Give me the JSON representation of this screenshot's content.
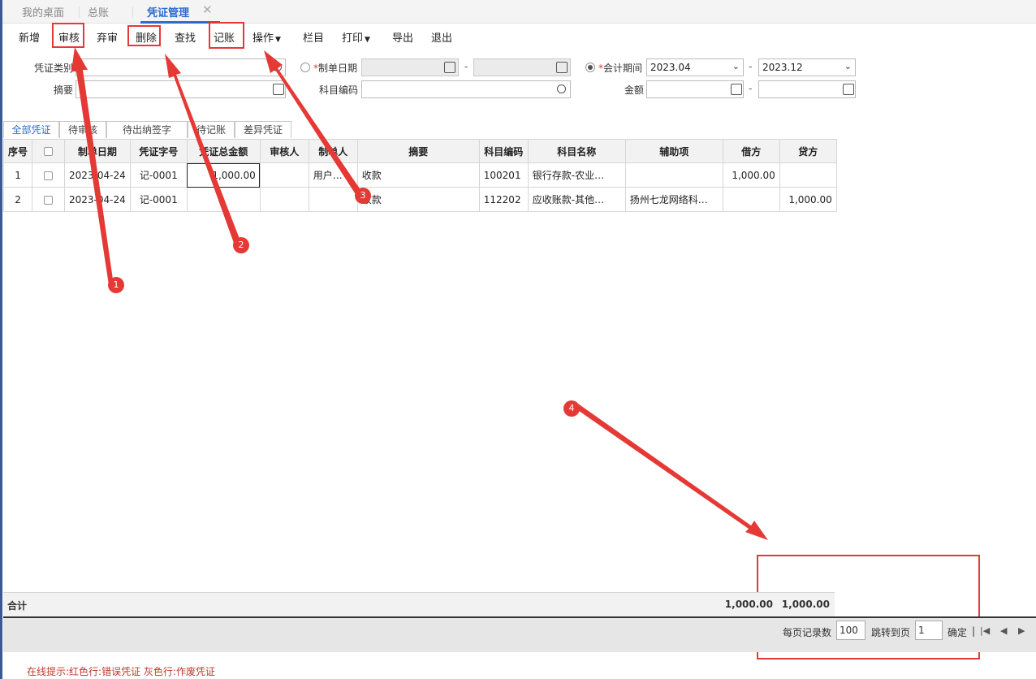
{
  "tabs": [
    {
      "label": "我的桌面"
    },
    {
      "label": "总账"
    },
    {
      "label": "凭证管理"
    }
  ],
  "toolbar": {
    "add": "新增",
    "audit": "审核",
    "abandon_audit": "弃审",
    "delete": "删除",
    "find": "查找",
    "post": "记账",
    "operate": "操作",
    "columns": "栏目",
    "print": "打印",
    "export": "导出",
    "exit": "退出"
  },
  "filters": {
    "voucher_type_label": "凭证类别",
    "voucher_type_value": "",
    "make_date_label": "制单日期",
    "make_date_from": "",
    "make_date_to": "",
    "period_label": "会计期间",
    "period_from": "2023.04",
    "period_to": "2023.12",
    "summary_label": "摘要",
    "summary_value": "",
    "account_code_label": "科目编码",
    "account_code_value": "",
    "amount_label": "金额",
    "amount_from": "",
    "amount_to": "",
    "dash": "-"
  },
  "subtabs": [
    "全部凭证",
    "待审核",
    "待出纳签字",
    "待记账",
    "差异凭证"
  ],
  "table": {
    "headers": [
      "序号",
      "",
      "制单日期",
      "凭证字号",
      "凭证总金额",
      "审核人",
      "制单人",
      "摘要",
      "科目编码",
      "科目名称",
      "辅助项",
      "借方",
      "贷方"
    ],
    "rows": [
      {
        "seq": "1",
        "date": "2023-04-24",
        "voucher_no": "记-0001",
        "total": "1,000.00",
        "auditor": "",
        "maker": "用户…",
        "summary": "收款",
        "code": "100201",
        "name": "银行存款-农业…",
        "aux": "",
        "debit": "1,000.00",
        "credit": ""
      },
      {
        "seq": "2",
        "date": "2023-04-24",
        "voucher_no": "记-0001",
        "total": "",
        "auditor": "",
        "maker": "",
        "summary": "收款",
        "code": "112202",
        "name": "应收账款-其他…",
        "aux": "扬州七龙网络科…",
        "debit": "",
        "credit": "1,000.00"
      }
    ]
  },
  "totals": {
    "label": "合计",
    "debit": "1,000.00",
    "credit": "1,000.00"
  },
  "pager": {
    "page_size_label": "每页记录数",
    "page_size": "100",
    "jump_label": "跳转到页",
    "page": "1",
    "confirm": "确定",
    "sep": "|"
  },
  "footer_hint": "在线提示:红色行:错误凭证 灰色行:作废凭证",
  "markers": [
    "1",
    "2",
    "3",
    "4"
  ],
  "colors": {
    "accent": "#2c6bd1",
    "annotation": "#e53935"
  }
}
